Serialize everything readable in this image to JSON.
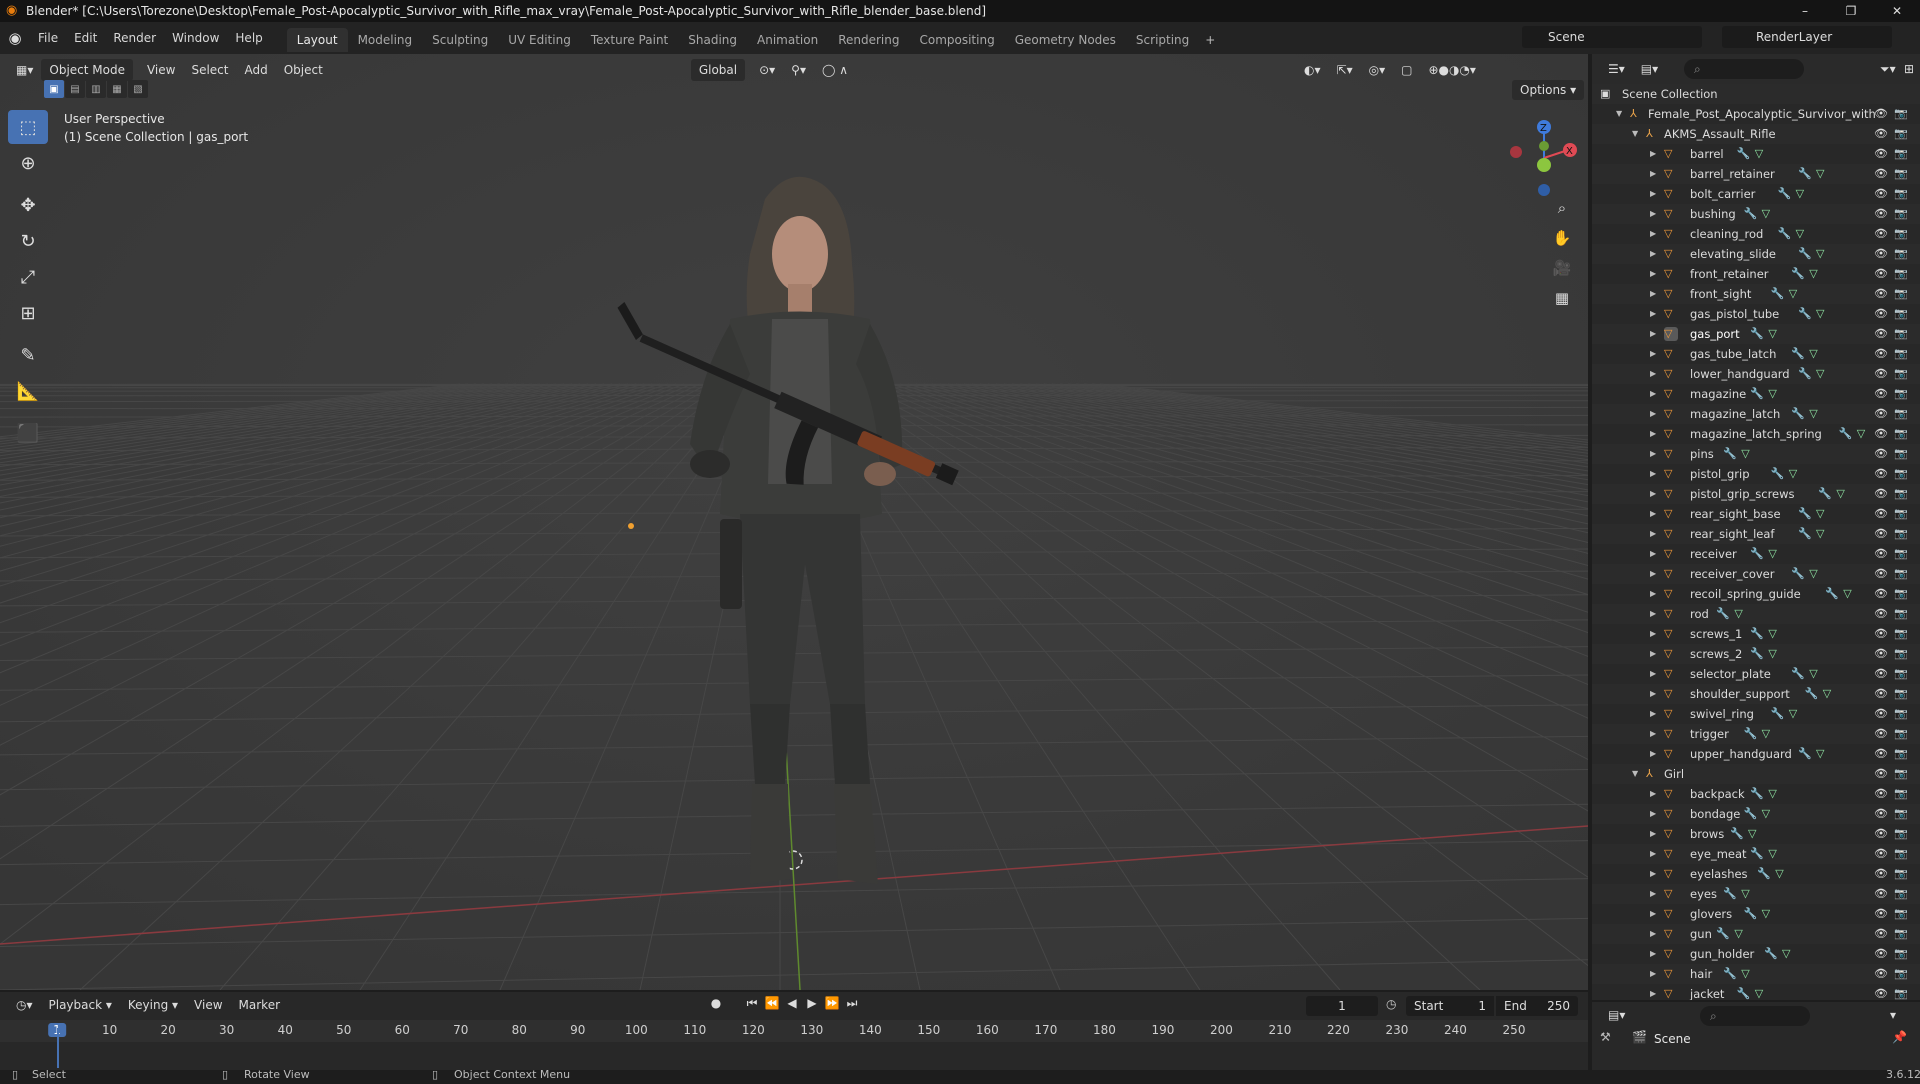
{
  "titlebar": {
    "title": "Blender* [C:\\Users\\Torezone\\Desktop\\Female_Post-Apocalyptic_Survivor_with_Rifle_max_vray\\Female_Post-Apocalyptic_Survivor_with_Rifle_blender_base.blend]",
    "min": "–",
    "max": "❐",
    "close": "✕"
  },
  "menu": [
    "File",
    "Edit",
    "Render",
    "Window",
    "Help"
  ],
  "workspaces": [
    "Layout",
    "Modeling",
    "Sculpting",
    "UV Editing",
    "Texture Paint",
    "Shading",
    "Animation",
    "Rendering",
    "Compositing",
    "Geometry Nodes",
    "Scripting"
  ],
  "workspace_add": "+",
  "scene": "Scene",
  "view_layer": "RenderLayer",
  "viewport": {
    "mode": "Object Mode",
    "menus": [
      "View",
      "Select",
      "Add",
      "Object"
    ],
    "orientation": "Global",
    "options": "Options",
    "overlay_line1": "User Perspective",
    "overlay_line2": "(1) Scene Collection | gas_port",
    "gizmo": {
      "z": "Z",
      "y": "Y",
      "x": "X"
    }
  },
  "outliner": {
    "root": "Scene Collection",
    "collection": "Female_Post_Apocalyptic_Survivor_with",
    "sub1": "AKMS_Assault_Rifle",
    "rifle_items": [
      "barrel",
      "barrel_retainer",
      "bolt_carrier",
      "bushing",
      "cleaning_rod",
      "elevating_slide",
      "front_retainer",
      "front_sight",
      "gas_pistol_tube",
      "gas_port",
      "gas_tube_latch",
      "lower_handguard",
      "magazine",
      "magazine_latch",
      "magazine_latch_spring",
      "pins",
      "pistol_grip",
      "pistol_grip_screws",
      "rear_sight_base",
      "rear_sight_leaf",
      "receiver",
      "receiver_cover",
      "recoil_spring_guide",
      "rod",
      "screws_1",
      "screws_2",
      "selector_plate",
      "shoulder_support",
      "swivel_ring",
      "trigger",
      "upper_handguard"
    ],
    "sub2": "Girl",
    "girl_items": [
      "backpack",
      "bondage",
      "brows",
      "eye_meat",
      "eyelashes",
      "eyes",
      "glovers",
      "gun",
      "gun_holder",
      "hair",
      "jacket"
    ],
    "selected": "gas_port"
  },
  "properties": {
    "scene": "Scene",
    "version": "3.6.12"
  },
  "timeline": {
    "menus": [
      "Playback",
      "Keying",
      "View",
      "Marker"
    ],
    "current_frame": "1",
    "start_label": "Start",
    "start": "1",
    "end_label": "End",
    "end": "250",
    "ruler": [
      "1",
      "10",
      "20",
      "30",
      "40",
      "50",
      "60",
      "70",
      "80",
      "90",
      "100",
      "110",
      "120",
      "130",
      "140",
      "150",
      "160",
      "170",
      "180",
      "190",
      "200",
      "210",
      "220",
      "230",
      "240",
      "250"
    ]
  },
  "status": {
    "select": "Select",
    "rotate": "Rotate View",
    "context": "Object Context Menu"
  },
  "colors": {
    "accent": "#4772b3",
    "orange": "#e87d0d",
    "x_axis": "#e04a54",
    "y_axis": "#8cc63f",
    "z_axis": "#3f7bdc"
  }
}
